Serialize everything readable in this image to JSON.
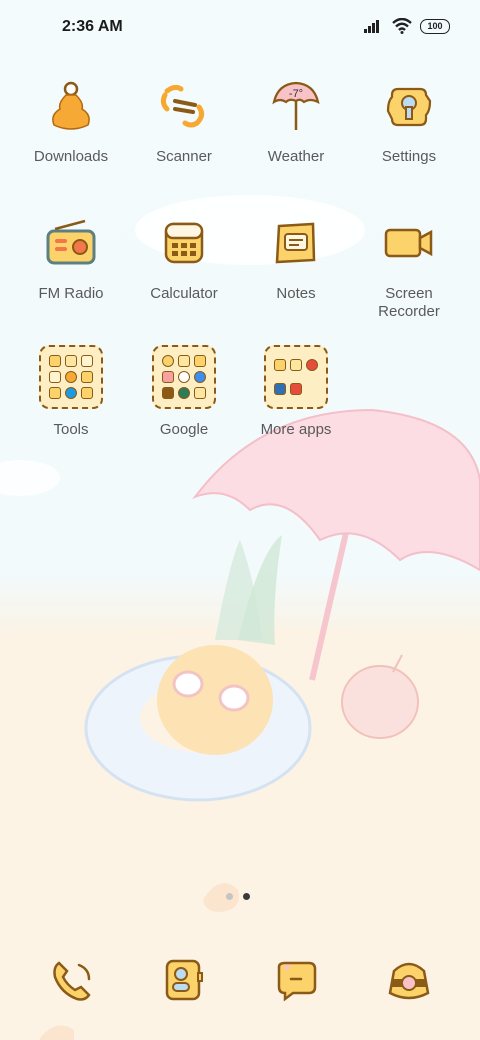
{
  "status_bar": {
    "time": "2:36 AM",
    "battery": "100"
  },
  "apps": [
    {
      "name": "Downloads",
      "icon": "downloads-icon"
    },
    {
      "name": "Scanner",
      "icon": "scanner-icon"
    },
    {
      "name": "Weather",
      "icon": "weather-icon",
      "temperature": "-7°"
    },
    {
      "name": "Settings",
      "icon": "settings-icon"
    },
    {
      "name": "FM Radio",
      "icon": "radio-icon"
    },
    {
      "name": "Calculator",
      "icon": "calculator-icon"
    },
    {
      "name": "Notes",
      "icon": "notes-icon"
    },
    {
      "name": "Screen Recorder",
      "icon": "screen-recorder-icon"
    }
  ],
  "folders": [
    {
      "name": "Tools"
    },
    {
      "name": "Google"
    },
    {
      "name": "More apps"
    }
  ],
  "page_indicator": {
    "pages": 2,
    "current": 2
  },
  "dock": [
    {
      "icon": "phone-icon"
    },
    {
      "icon": "contacts-icon"
    },
    {
      "icon": "messages-icon"
    },
    {
      "icon": "camera-icon"
    }
  ],
  "colors": {
    "icon_fill": "#fbd36a",
    "icon_outline": "#8a5a16",
    "label_text": "#5a5a5a",
    "umbrella_pink": "#f7c9d2"
  }
}
